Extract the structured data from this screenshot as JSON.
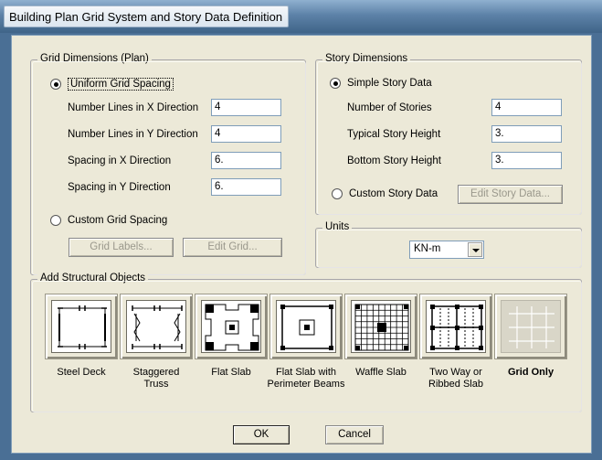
{
  "window": {
    "title": "Building Plan Grid System and Story Data Definition"
  },
  "grid_dimensions": {
    "legend": "Grid Dimensions (Plan)",
    "uniform_label": "Uniform Grid Spacing",
    "fields": [
      {
        "label": "Number Lines in X Direction",
        "value": "4"
      },
      {
        "label": "Number Lines in Y Direction",
        "value": "4"
      },
      {
        "label": "Spacing in X Direction",
        "value": "6."
      },
      {
        "label": "Spacing in Y Direction",
        "value": "6."
      }
    ],
    "custom_label": "Custom Grid Spacing",
    "grid_labels_button": "Grid Labels...",
    "edit_grid_button": "Edit Grid..."
  },
  "story_dimensions": {
    "legend": "Story Dimensions",
    "simple_label": "Simple Story Data",
    "fields": [
      {
        "label": "Number of Stories",
        "value": "4"
      },
      {
        "label": "Typical Story Height",
        "value": "3."
      },
      {
        "label": "Bottom Story Height",
        "value": "3."
      }
    ],
    "custom_label": "Custom Story Data",
    "edit_story_button": "Edit Story Data..."
  },
  "units": {
    "legend": "Units",
    "selected": "KN-m"
  },
  "structural_objects": {
    "legend": "Add Structural Objects",
    "items": [
      {
        "caption1": "Steel Deck",
        "caption2": "",
        "icon": "steel-deck-icon"
      },
      {
        "caption1": "Staggered",
        "caption2": "Truss",
        "icon": "staggered-truss-icon"
      },
      {
        "caption1": "Flat Slab",
        "caption2": "",
        "icon": "flat-slab-icon"
      },
      {
        "caption1": "Flat Slab with",
        "caption2": "Perimeter Beams",
        "icon": "flat-slab-perimeter-beams-icon"
      },
      {
        "caption1": "Waffle Slab",
        "caption2": "",
        "icon": "waffle-slab-icon"
      },
      {
        "caption1": "Two Way or",
        "caption2": "Ribbed Slab",
        "icon": "two-way-ribbed-slab-icon"
      },
      {
        "caption1": "Grid Only",
        "caption2": "",
        "icon": "grid-only-icon"
      }
    ]
  },
  "buttons": {
    "ok": "OK",
    "cancel": "Cancel"
  }
}
